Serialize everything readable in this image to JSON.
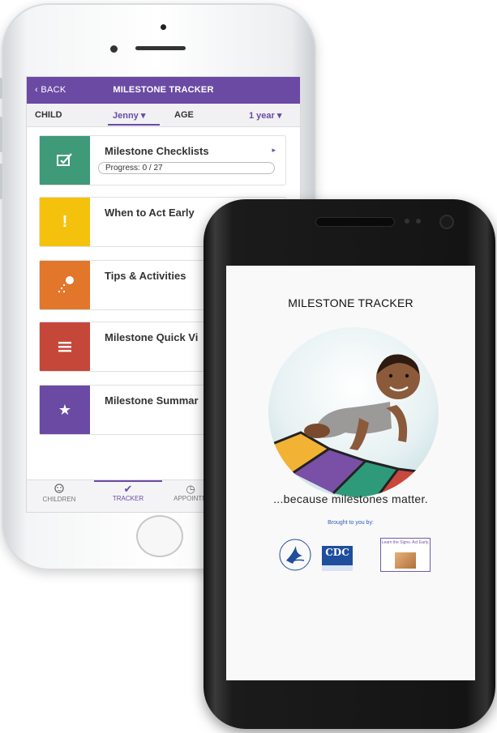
{
  "iphone": {
    "topbar": {
      "back_label": "‹ BACK",
      "title": "MILESTONE TRACKER"
    },
    "childbar": {
      "child_label": "CHILD",
      "child_value": "Jenny ▾",
      "age_label": "AGE",
      "age_value": "1 year ▾"
    },
    "cards": [
      {
        "title": "Milestone Checklists",
        "color": "#3f9a7a",
        "icon": "checkbox-icon",
        "progress": "Progress: 0 / 27"
      },
      {
        "title": "When to Act Early",
        "color": "#f4c20d",
        "icon": "exclamation-icon"
      },
      {
        "title": "Tips & Activities",
        "color": "#e2762a",
        "icon": "ball-toss-icon"
      },
      {
        "title": "Milestone Quick Vi",
        "color": "#c4473a",
        "icon": "list-lines-icon"
      },
      {
        "title": "Milestone Summar",
        "color": "#6b4aa4",
        "icon": "star-icon"
      }
    ],
    "tabs": [
      {
        "label": "CHILDREN",
        "icon": "child-face-icon"
      },
      {
        "label": "TRACKER",
        "icon": "checkmark-icon"
      },
      {
        "label": "APPOINTM",
        "icon": "clock-icon"
      }
    ]
  },
  "android": {
    "title": "MILESTONE TRACKER",
    "tagline": "...because milestones matter.",
    "brought_by": "Brought to you by:",
    "logos": {
      "cdc": "CDC",
      "learn_the_signs": "Learn the Signs. Act Early."
    }
  },
  "colors": {
    "accent": "#6b4aa4"
  }
}
